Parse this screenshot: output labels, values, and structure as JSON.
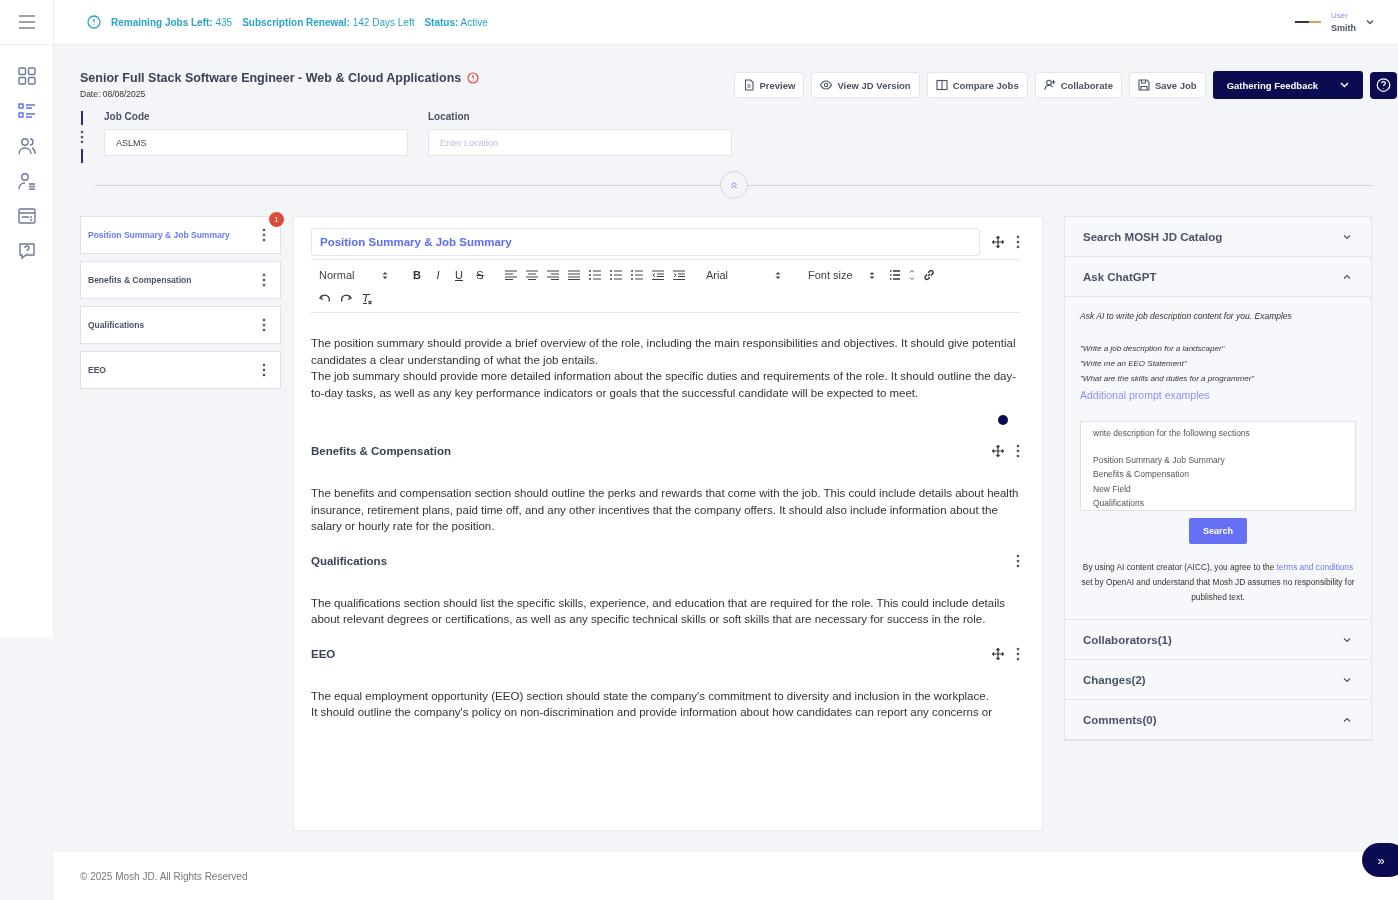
{
  "topbar": {
    "stats": [
      {
        "label": "Remaining Jobs Left:",
        "value": "435"
      },
      {
        "label": "Subscription Renewal:",
        "value": "142 Days Left"
      },
      {
        "label": "Status:",
        "value": "Active"
      }
    ],
    "user": {
      "role": "User",
      "name": "Smith"
    }
  },
  "nav": [
    {
      "selected": false
    },
    {
      "selected": true
    },
    {
      "selected": false
    },
    {
      "selected": false
    },
    {
      "selected": false
    },
    {
      "selected": false
    }
  ],
  "job": {
    "title": "Senior Full Stack Software Engineer - Web & Cloud Applications",
    "date": "Date: 08/08/2025"
  },
  "actions": [
    {
      "label": "Preview"
    },
    {
      "label": "View JD Version"
    },
    {
      "label": "Compare Jobs"
    },
    {
      "label": "Collaborate"
    },
    {
      "label": "Save Job"
    }
  ],
  "status_button": "Gathering Feedback",
  "fields": [
    {
      "label": "Job Code",
      "value": "ASLMS"
    },
    {
      "label": "Location",
      "placeholder": "Enter Location"
    }
  ],
  "section_list": [
    {
      "label": "Position Summary & Job Summary",
      "selected": true,
      "badge": "1"
    },
    {
      "label": "Benefits & Compensation",
      "selected": false
    },
    {
      "label": "Qualifications",
      "selected": false
    },
    {
      "label": "EEO",
      "selected": false
    }
  ],
  "toolbar": {
    "format": "Normal",
    "marks": [
      "B",
      "I",
      "U",
      "S"
    ],
    "font": "Arial",
    "size": "Font size"
  },
  "sections": [
    {
      "title": "Position Summary & Job Summary",
      "active": true,
      "movable": true,
      "paragraphs": [
        "The position summary should provide a brief overview of the role, including the main responsibilities and objectives. It should give potential candidates a clear understanding of what the job entails.",
        "The job summary should provide more detailed information about the specific duties and requirements of the role. It should outline the day-to-day tasks, as well as any key performance indicators or goals that the successful candidate will be expected to meet."
      ]
    },
    {
      "title": "Benefits & Compensation",
      "active": false,
      "movable": true,
      "paragraphs": [
        "The benefits and compensation section should outline the perks and rewards that come with the job. This could include details about health insurance, retirement plans, paid time off, and any other incentives that the company offers. It should also include information about the salary or hourly rate for the position."
      ]
    },
    {
      "title": "Qualifications",
      "active": false,
      "movable": false,
      "paragraphs": [
        "The qualifications section should list the specific skills, experience, and education that are required for the role. This could include details about relevant degrees or certifications, as well as any specific technical skills or soft skills that are necessary for success in the role."
      ]
    },
    {
      "title": "EEO",
      "active": false,
      "movable": true,
      "paragraphs": [
        "The equal employment opportunity (EEO) section should state the company's commitment to diversity and inclusion in the workplace.",
        "It should outline the company's policy on non-discrimination and provide information about how candidates can report any concerns or"
      ]
    }
  ],
  "panels": [
    {
      "title": "Search MOSH JD Catalog",
      "expanded": false
    },
    {
      "title": "Ask ChatGPT",
      "expanded": true,
      "intro": "Ask AI to write job description content for you. Examples",
      "examples": [
        "\"Write a job description for a landscaper\"",
        "\"Write me an EEO Statement\"",
        "\"What are the skills and duties for a programmer\""
      ],
      "link": "Additional prompt examples",
      "prompt_heading": "write description for the following sections",
      "prompt": [
        "Position Summary & Job Summary",
        "Benefits & Compensation",
        "New Field",
        "Qualifications"
      ],
      "button": "Search",
      "disclaimer": {
        "before": "By using AI content creator (AICC), you agree to the",
        "link": "terms and conditions",
        "after": "set by OpenAI and understand that Mosh JD assumes no responsibility for published text."
      }
    },
    {
      "title": "Collaborators(1)",
      "expanded": false
    },
    {
      "title": "Changes(2)",
      "expanded": false
    },
    {
      "title": "Comments(0)",
      "expanded": true
    }
  ],
  "footer": "© 2025 Mosh JD. All Rights Reserved",
  "fab": "»"
}
